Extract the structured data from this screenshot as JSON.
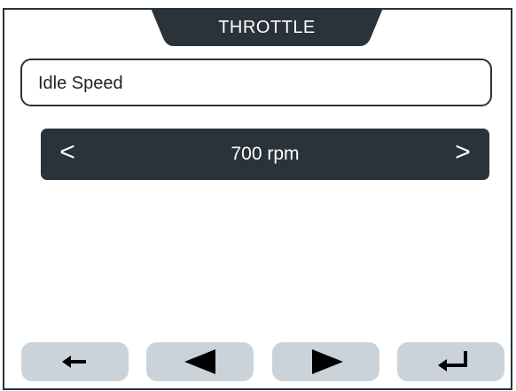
{
  "header": {
    "title": "THROTTLE"
  },
  "parameter": {
    "name": "Idle Speed"
  },
  "value_selector": {
    "prev_label": "<",
    "value": "700 rpm",
    "next_label": ">"
  },
  "soft_keys": [
    {
      "icon": "arrow-left-back-icon"
    },
    {
      "icon": "triangle-left-icon"
    },
    {
      "icon": "triangle-right-icon"
    },
    {
      "icon": "enter-icon"
    }
  ],
  "colors": {
    "dark": "#2a323a",
    "button_bg": "#cbd3da",
    "background": "#ffffff"
  }
}
